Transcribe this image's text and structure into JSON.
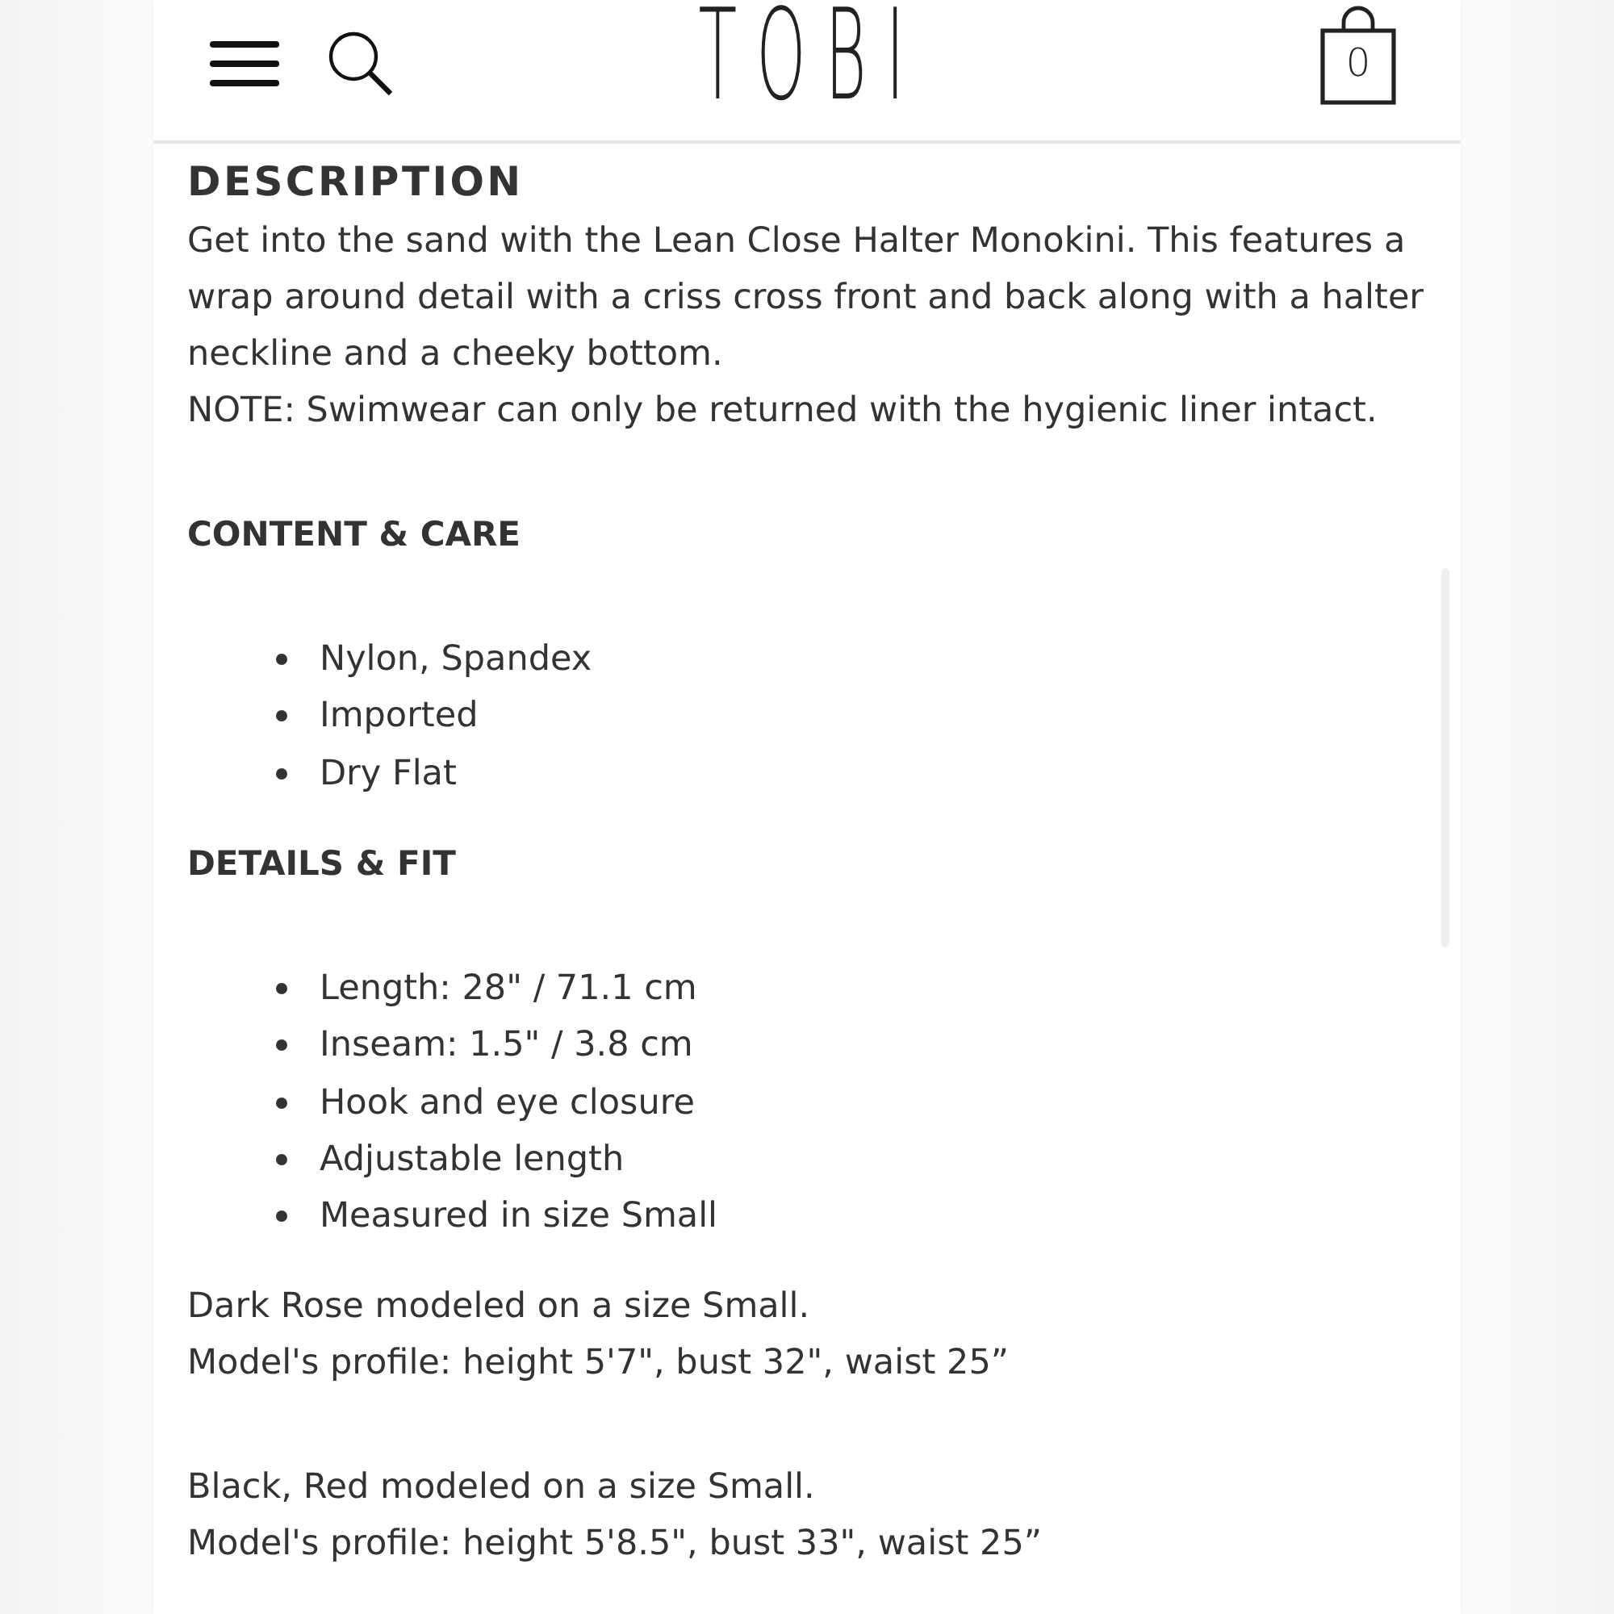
{
  "header": {
    "logo": "TOBI",
    "cart_count": "0"
  },
  "sections": [
    {
      "kind": "intro",
      "heading": "DESCRIPTION",
      "paragraphs": [
        "Get into the sand with the Lean Close Halter Monokini. This features a wrap around detail with a criss cross front and back along with a halter neckline and a cheeky bottom.",
        "NOTE: Swimwear can only be returned with the hygienic liner intact."
      ]
    },
    {
      "kind": "list",
      "heading": "CONTENT & CARE",
      "items": [
        "Nylon, Spandex",
        "Imported",
        "Dry Flat"
      ]
    },
    {
      "kind": "list",
      "heading": "DETAILS & FIT",
      "items": [
        "Length: 28\" / 71.1 cm",
        "Inseam: 1.5\" / 3.8 cm",
        "Hook and eye closure",
        "Adjustable length",
        "Measured in size Small"
      ]
    }
  ],
  "model_notes": [
    {
      "lines": [
        "Dark Rose modeled on a size Small.",
        "Model's profile: height 5'7\", bust 32\", waist 25”"
      ]
    },
    {
      "lines": [
        "Black, Red modeled on a size Small.",
        "Model's profile: height 5'8.5\", bust 33\", waist 25”"
      ]
    }
  ]
}
